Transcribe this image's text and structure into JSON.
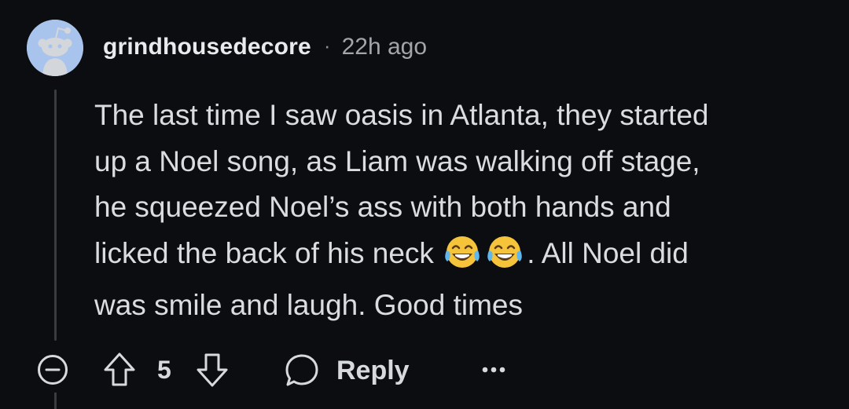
{
  "comment": {
    "author": "grindhousedecore",
    "separator": "·",
    "timestamp": "22h ago",
    "avatar_icon": "snoo-avatar-icon",
    "body": {
      "line1": "The last time I saw oasis in Atlanta, they started",
      "line2": "up a Noel song, as Liam was walking off stage,",
      "line3": "he squeezed Noel’s ass with both hands and",
      "line4_before_emoji": "licked the back of his neck ",
      "emoji": "face-with-tears-of-joy-icon",
      "line4_after_emoji": ". All Noel did",
      "line5": "was smile and laugh. Good times"
    }
  },
  "actions": {
    "collapse_icon": "minus-circle-icon",
    "upvote_icon": "arrow-up-icon",
    "score": "5",
    "downvote_icon": "arrow-down-icon",
    "reply_icon": "speech-bubble-icon",
    "reply_label": "Reply",
    "more_icon": "ellipsis-icon"
  },
  "colors": {
    "background": "#0c0d10",
    "text": "#dadcdf",
    "muted": "#a2a6aa",
    "avatar_bg": "#a9c4ec",
    "thread_line": "#3a3c3f"
  }
}
